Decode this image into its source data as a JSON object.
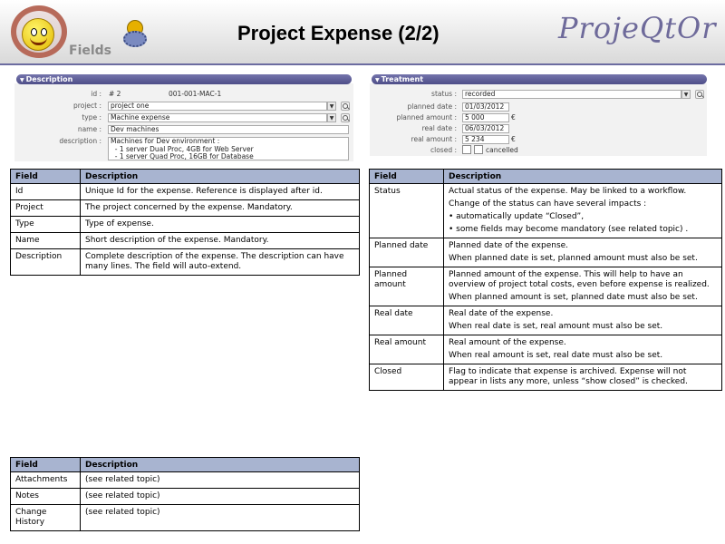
{
  "header": {
    "title": "Project Expense (2/2)",
    "brand": "ProjeQtOr",
    "logo_caption": "Fields"
  },
  "description_form": {
    "section_title": "Description",
    "id_label": "id :",
    "id_value": "# 2",
    "id_reference": "001-001-MAC-1",
    "project_label": "project :",
    "project_value": "project one",
    "type_label": "type :",
    "type_value": "Machine expense",
    "name_label": "name :",
    "name_value": "Dev machines",
    "description_label": "description :",
    "description_value": "Machines for Dev environment :\n  - 1 server Dual Proc, 4GB for Web Server\n  - 1 server Quad Proc, 16GB for Database"
  },
  "treatment_form": {
    "section_title": "Treatment",
    "status_label": "status :",
    "status_value": "recorded",
    "planned_date_label": "planned date :",
    "planned_date_value": "01/03/2012",
    "planned_amount_label": "planned amount :",
    "planned_amount_value": "5 000",
    "real_date_label": "real date :",
    "real_date_value": "06/03/2012",
    "real_amount_label": "real amount :",
    "real_amount_value": "5 234",
    "currency": "€",
    "closed_label": "closed :",
    "cancelled_label": "cancelled"
  },
  "table_description": {
    "headers": [
      "Field",
      "Description"
    ],
    "rows": [
      {
        "field": "Id",
        "desc": [
          "Unique Id for the expense. Reference is displayed after id."
        ]
      },
      {
        "field": "Project",
        "desc": [
          "The project concerned by the expense. Mandatory."
        ]
      },
      {
        "field": "Type",
        "desc": [
          "Type of expense."
        ]
      },
      {
        "field": "Name",
        "desc": [
          "Short description of the expense. Mandatory."
        ]
      },
      {
        "field": "Description",
        "desc": [
          "Complete description of the expense. The description can have many lines. The field will auto-extend."
        ]
      }
    ]
  },
  "table_treatment": {
    "headers": [
      "Field",
      "Description"
    ],
    "rows": [
      {
        "field": "Status",
        "desc": [
          "Actual status of the expense. May be linked to a workflow.",
          "Change of the status can have several impacts :",
          "• automatically update “Closed”,",
          "• some fields may become mandatory (see related topic) ."
        ]
      },
      {
        "field": "Planned date",
        "desc": [
          "Planned date of the expense.",
          "When planned date is set, planned amount must also be set."
        ]
      },
      {
        "field": "Planned amount",
        "desc": [
          "Planned amount of the expense. This will help to have an overview of  project total costs, even before expense is realized.",
          "When planned amount is set, planned date must also be set."
        ]
      },
      {
        "field": "Real date",
        "desc": [
          "Real date of the expense.",
          "When real date is set, real amount must also be set."
        ]
      },
      {
        "field": "Real amount",
        "desc": [
          "Real amount of the expense.",
          "When real amount is set, real date must also be set."
        ]
      },
      {
        "field": "Closed",
        "desc": [
          "Flag to indicate that expense is archived. Expense will not appear in lists any more, unless “show closed” is checked."
        ]
      }
    ]
  },
  "table_other": {
    "headers": [
      "Field",
      "Description"
    ],
    "rows": [
      {
        "field": "Attachments",
        "desc": [
          "(see related topic)"
        ]
      },
      {
        "field": "Notes",
        "desc": [
          "(see related topic)"
        ]
      },
      {
        "field": "Change History",
        "desc": [
          "(see related topic)"
        ]
      }
    ]
  }
}
